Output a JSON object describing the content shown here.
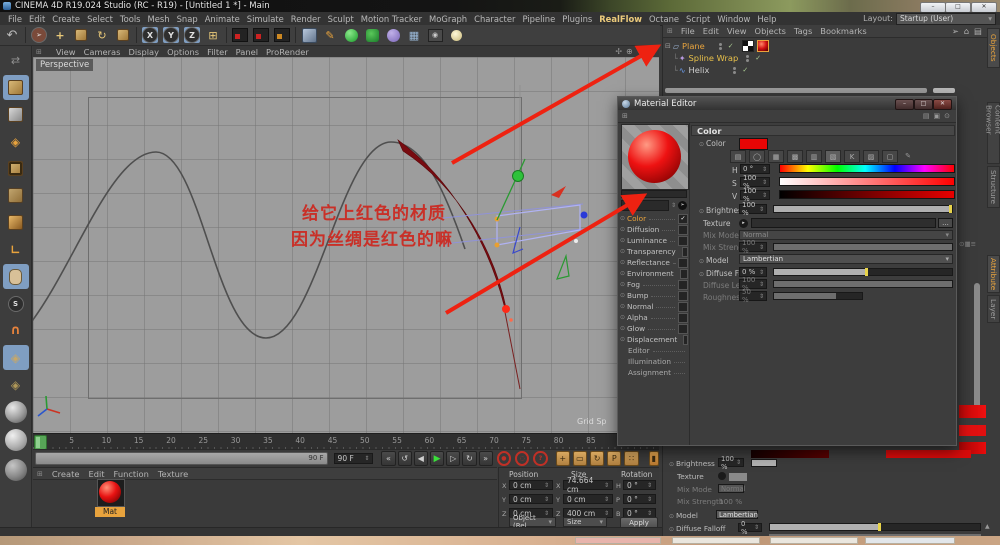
{
  "titlebar": {
    "title": "CINEMA 4D R19.024 Studio (RC - R19) - [Untitled 1 *] - Main"
  },
  "menubar": {
    "items": [
      "File",
      "Edit",
      "Create",
      "Select",
      "Tools",
      "Mesh",
      "Snap",
      "Animate",
      "Simulate",
      "Render",
      "Sculpt",
      "Motion Tracker",
      "MoGraph",
      "Character",
      "Pipeline",
      "Plugins",
      "RealFlow",
      "Octane",
      "Script",
      "Window",
      "Help"
    ],
    "layout_label": "Layout:",
    "layout_value": "Startup (User)"
  },
  "viewport": {
    "menu": [
      "View",
      "Cameras",
      "Display",
      "Options",
      "Filter",
      "Panel",
      "ProRender"
    ],
    "view_label": "Perspective",
    "grid_label": "Grid Sp",
    "annotation": {
      "line1": "给它上红色的材质",
      "line2": "因为丝绸是红色的嘛"
    }
  },
  "timeline": {
    "ticks": [
      "0",
      "5",
      "10",
      "15",
      "20",
      "25",
      "30",
      "35",
      "40",
      "45",
      "50",
      "55",
      "60",
      "65",
      "70",
      "75",
      "80",
      "85"
    ],
    "range_end": "90 F",
    "frame_field": "90 F"
  },
  "object_manager": {
    "menu": [
      "File",
      "Edit",
      "View",
      "Objects",
      "Tags",
      "Bookmarks"
    ],
    "items": [
      {
        "name": "Plane"
      },
      {
        "name": "Spline Wrap"
      },
      {
        "name": "Helix"
      }
    ],
    "tab_objects": "Objects",
    "tab_content_browser": "Content Browser",
    "tab_structure": "Structure",
    "tab_attribute": "Attribute",
    "tab_layer": "Layer"
  },
  "material_editor": {
    "title": "Material Editor",
    "section_header": "Color",
    "channels": [
      {
        "label": "Color",
        "state": "checked"
      },
      {
        "label": "Diffusion",
        "state": "unchecked"
      },
      {
        "label": "Luminance",
        "state": "unchecked"
      },
      {
        "label": "Transparency",
        "state": "unchecked"
      },
      {
        "label": "Reflectance",
        "state": "unchecked"
      },
      {
        "label": "Environment",
        "state": "unchecked"
      },
      {
        "label": "Fog",
        "state": "unchecked"
      },
      {
        "label": "Bump",
        "state": "unchecked"
      },
      {
        "label": "Normal",
        "state": "unchecked"
      },
      {
        "label": "Alpha",
        "state": "unchecked"
      },
      {
        "label": "Glow",
        "state": "unchecked"
      },
      {
        "label": "Displacement",
        "state": "unchecked"
      },
      {
        "label": "Editor",
        "state": "none"
      },
      {
        "label": "Illumination",
        "state": "none"
      },
      {
        "label": "Assignment",
        "state": "none"
      }
    ],
    "props": {
      "color_label": "Color",
      "h_label": "H",
      "h_value": "0 °",
      "s_label": "S",
      "s_value": "100 %",
      "v_label": "V",
      "v_value": "100 %",
      "brightness_label": "Brightness",
      "brightness_value": "100 %",
      "texture_label": "Texture",
      "texture_browse": "...",
      "mix_mode_label": "Mix Mode",
      "mix_mode_value": "Normal",
      "mix_strength_label": "Mix Strength",
      "mix_strength_value": "100 %",
      "model_label": "Model",
      "model_value": "Lambertian",
      "diffuse_falloff_label": "Diffuse Falloff",
      "diffuse_falloff_value": "0 %",
      "diffuse_level_label": "Diffuse Level",
      "diffuse_level_value": "100 %",
      "roughness_label": "Roughness",
      "roughness_value": "50 %"
    }
  },
  "material_manager": {
    "menu": [
      "Create",
      "Edit",
      "Function",
      "Texture"
    ],
    "material_name": "Mat"
  },
  "coordinates": {
    "headers": [
      "Position",
      "Size",
      "Rotation"
    ],
    "letters": [
      "X",
      "Y",
      "Z",
      "X",
      "Y",
      "Z",
      "H",
      "P",
      "B"
    ],
    "position": {
      "x": "0 cm",
      "y": "0 cm",
      "z": "0 cm"
    },
    "size": {
      "x": "74.664 cm",
      "y": "0 cm",
      "z": "400 cm"
    },
    "rotation": {
      "h": "0 °",
      "p": "0 °",
      "b": "0 °"
    },
    "mode_object": "Object (Rel",
    "mode_size": "Size",
    "apply_label": "Apply"
  },
  "colors": {
    "accent_orange": "#e8a33d",
    "material_red": "#e81212",
    "annotation_red": "#ee2211"
  }
}
